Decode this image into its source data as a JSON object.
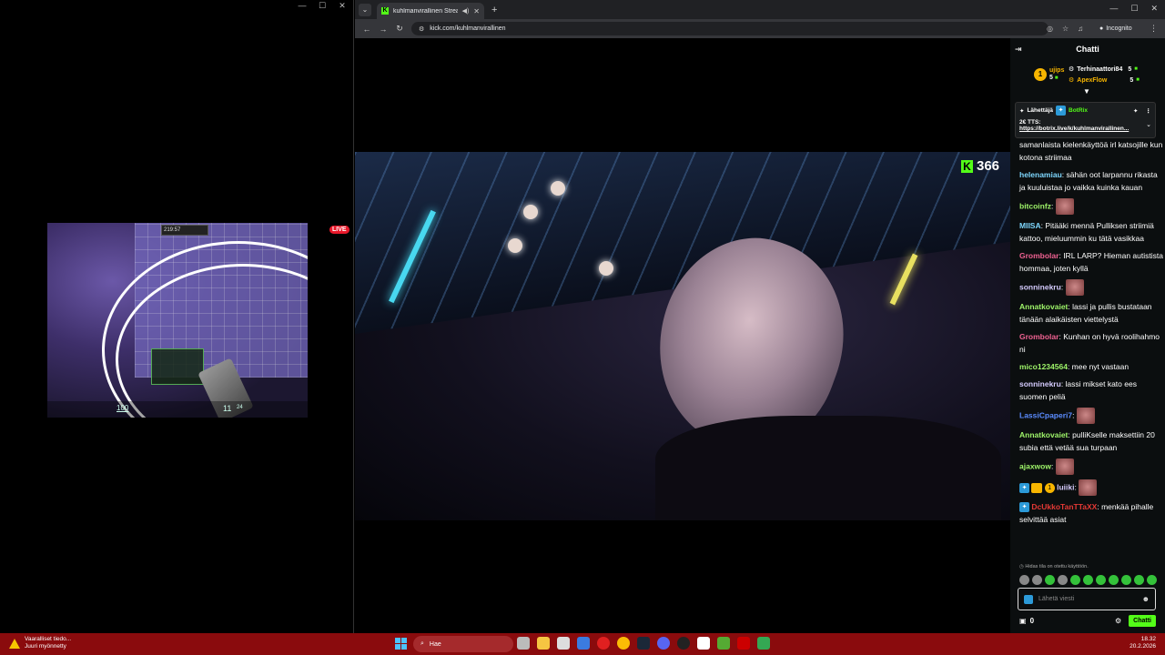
{
  "left_window": {
    "controls": [
      "—",
      "☐",
      "✕"
    ],
    "live_badge": "LIVE",
    "game_hud": {
      "top_timer": "219:57",
      "health": "100",
      "ammo": "11",
      "ammo_reserve": "24"
    }
  },
  "browser": {
    "tab_menu": "⌄",
    "tab_title": "kuhlmanvirallinen Stream",
    "tab_close": "✕",
    "new_tab": "+",
    "window_controls": [
      "—",
      "☐",
      "✕"
    ],
    "url": "kick.com/kuhlmanvirallinen",
    "incognito_label": "Incognito"
  },
  "stream": {
    "viewer_count": "366",
    "logo_letter": "K"
  },
  "chat": {
    "header_title": "Chatti",
    "leaderboard": [
      {
        "name": "ujips",
        "count": "5"
      },
      {
        "name": "Terhinaattori84",
        "count": "5"
      },
      {
        "name": "ApexFlow",
        "count": "5"
      }
    ],
    "pinned": {
      "sender_label": "Lähettäjä",
      "sender": "BotRix",
      "line1": "2€ TTS:",
      "link": "https://botrix.live/k/kuhlmanvirallinen..."
    },
    "messages": [
      {
        "user": "",
        "color": "#ffffff",
        "text": "samanlaista kielenkäyttöä irl katsojille kun kotona striimaa",
        "emote": false
      },
      {
        "user": "helenamiau",
        "color": "#7fd8ff",
        "text": "sähän oot larpannu rikasta ja kuuluistaa jo vaikka kuinka kauan",
        "emote": false
      },
      {
        "user": "bitcoinfz",
        "color": "#9ff56a",
        "text": "",
        "emote": true
      },
      {
        "user": "MIISA",
        "color": "#7fd8ff",
        "text": "Pitääki mennä Pulliksen striimiä kattoo, mieluummin ku tätä vasikkaa",
        "emote": false
      },
      {
        "user": "Grombolar",
        "color": "#f06292",
        "text": "IRL LARP? Hieman autistista hommaa, joten kyllä",
        "emote": false
      },
      {
        "user": "sonninekru",
        "color": "#d6ccff",
        "text": "",
        "emote": true
      },
      {
        "user": "Annatkovaiet",
        "color": "#9ff56a",
        "text": "lassi ja pullis bustataan tänään alaikäisten viettelystä",
        "emote": false
      },
      {
        "user": "Grombolar",
        "color": "#f06292",
        "text": "Kunhan on hyvä roolihahmo ni",
        "emote": false
      },
      {
        "user": "mico1234564",
        "color": "#9ff56a",
        "text": "mee nyt vastaan",
        "emote": false
      },
      {
        "user": "sonninekru",
        "color": "#d6ccff",
        "text": "lassi mikset kato ees suomen peliä",
        "emote": false
      },
      {
        "user": "LassiCpaperi7",
        "color": "#5b8cff",
        "text": "",
        "emote": true
      },
      {
        "user": "Annatkovaiet",
        "color": "#9ff56a",
        "text": "pulliKselle maksettiin 20 subia että vetää sua turpaan",
        "emote": false
      },
      {
        "user": "ajaxwow",
        "color": "#9ff56a",
        "text": "",
        "emote": true
      },
      {
        "user": "luiiki",
        "color": "#d6ccff",
        "text": "",
        "emote": true
      },
      {
        "user": "DcUkkoTanTTaXX",
        "color": "#e53935",
        "text": "menkää pihalle selvittää asiat",
        "emote": false
      }
    ],
    "slow_mode_note": "Hidas tila on otettu käyttöön.",
    "input_placeholder": "Lähetä viesti",
    "points": "0",
    "send_label": "Chatti"
  },
  "taskbar": {
    "notification_title": "Vaaralliset tiedo...",
    "notification_sub": "Juuri myönnetty",
    "search_placeholder": "Hae",
    "time": "18.32",
    "date": "20.2.2026",
    "accent": "#8a0b0d"
  }
}
